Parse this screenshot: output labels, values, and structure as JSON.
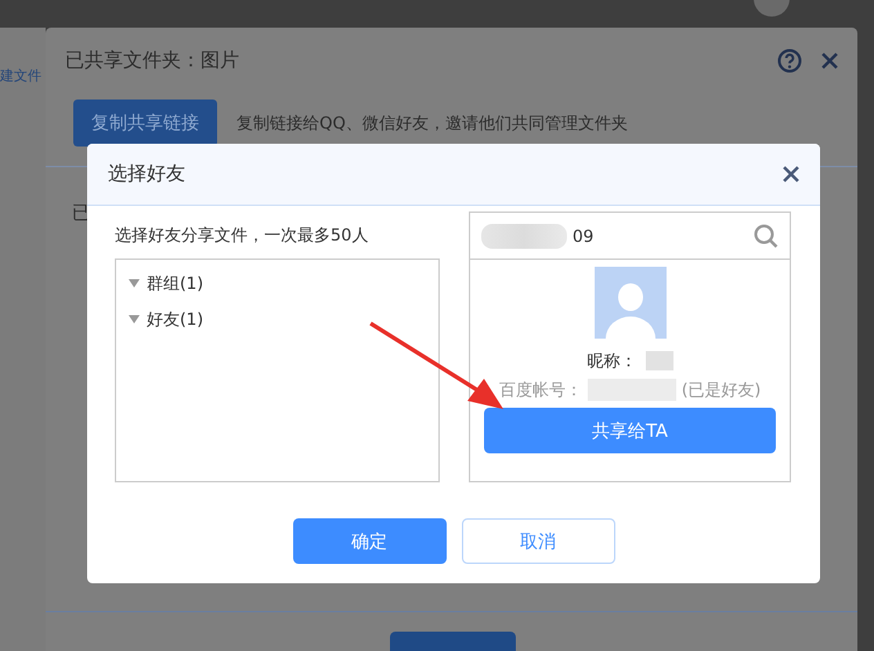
{
  "background_page": {
    "sidebar_link": "建文件"
  },
  "share_dialog": {
    "title": "已共享文件夹：图片",
    "copy_button": "复制共享链接",
    "description": "复制链接给QQ、微信好友，邀请他们共同管理文件夹",
    "row_text": "已"
  },
  "friend_dialog": {
    "title": "选择好友",
    "hint": "选择好友分享文件，一次最多50人",
    "tree": [
      {
        "label": "群组(1)",
        "expanded": true
      },
      {
        "label": "好友(1)",
        "expanded": true
      }
    ],
    "search": {
      "value": "09"
    },
    "result": {
      "nickname_label": "昵称：",
      "account_label": "百度帐号：",
      "status": "(已是好友)",
      "share_button": "共享给TA"
    },
    "buttons": [
      {
        "label": "确定",
        "kind": "primary"
      },
      {
        "label": "取消",
        "kind": "secondary"
      }
    ]
  }
}
